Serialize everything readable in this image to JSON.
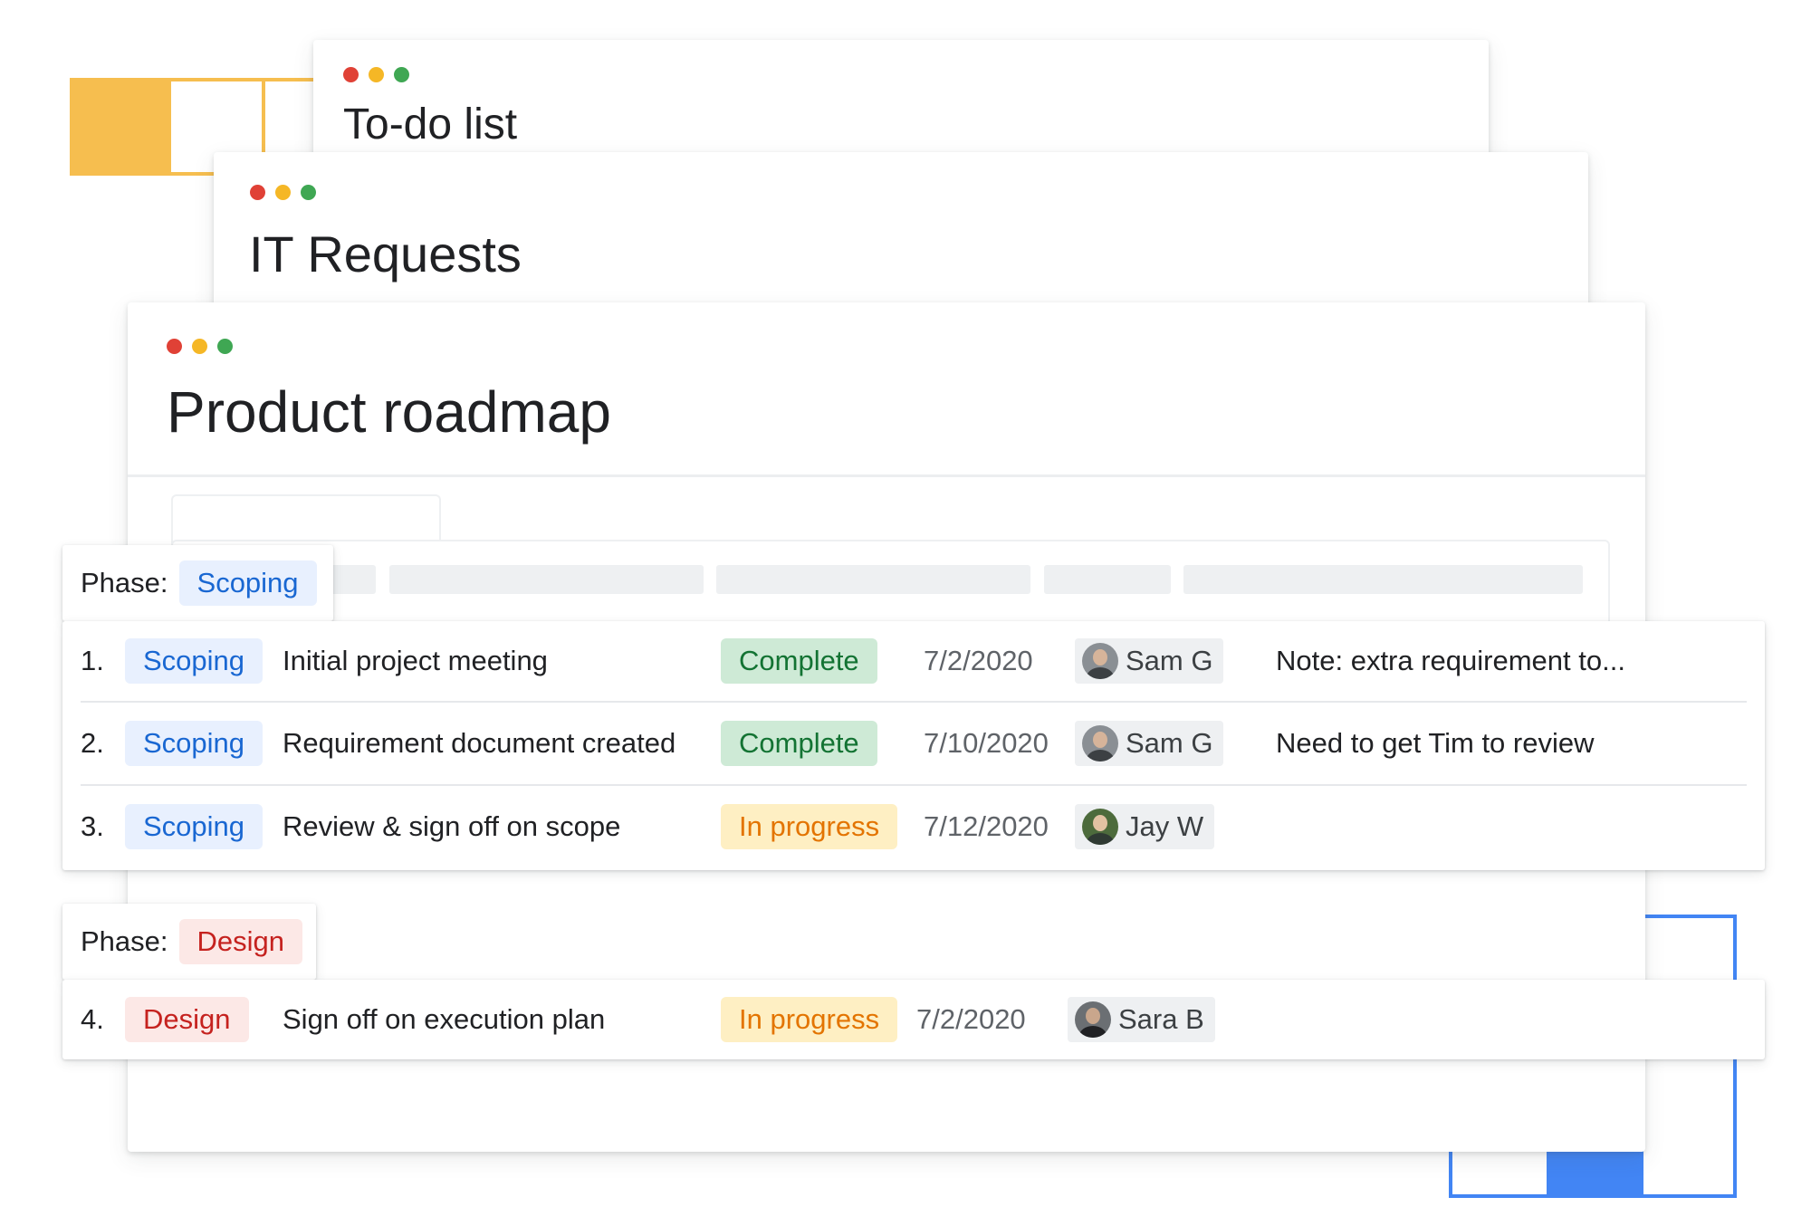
{
  "windows": {
    "todo": {
      "title": "To-do list"
    },
    "it_requests": {
      "title": "IT Requests"
    },
    "roadmap": {
      "title": "Product roadmap"
    }
  },
  "colors": {
    "dot_red": "#E04136",
    "dot_yellow": "#F5B726",
    "dot_green": "#3FA753",
    "deco_yellow": "#F6BE4F",
    "deco_blue": "#4285F4"
  },
  "groups": [
    {
      "phase_label": "Phase:",
      "phase": "Scoping",
      "rows": [
        {
          "num": "1.",
          "phase": "Scoping",
          "task": "Initial project meeting",
          "status": "Complete",
          "date": "7/2/2020",
          "assignee": "Sam G",
          "note": "Note: extra requirement to..."
        },
        {
          "num": "2.",
          "phase": "Scoping",
          "task": "Requirement document created",
          "status": "Complete",
          "date": "7/10/2020",
          "assignee": "Sam G",
          "note": "Need to get Tim to review"
        },
        {
          "num": "3.",
          "phase": "Scoping",
          "task": "Review & sign off on scope",
          "status": "In progress",
          "date": "7/12/2020",
          "assignee": "Jay W",
          "note": ""
        }
      ]
    },
    {
      "phase_label": "Phase:",
      "phase": "Design",
      "rows": [
        {
          "num": "4.",
          "phase": "Design",
          "task": "Sign off on execution plan",
          "status": "In progress",
          "date": "7/2/2020",
          "assignee": "Sara B",
          "note": ""
        }
      ]
    }
  ]
}
